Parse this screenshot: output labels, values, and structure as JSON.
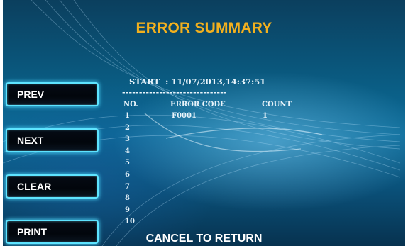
{
  "title": "ERROR SUMMARY",
  "buttons": {
    "prev": "PREV",
    "next": "NEXT",
    "clear": "CLEAR",
    "print": "PRINT"
  },
  "report": {
    "start_line": "START  : 11/07/2013,14:37:51",
    "divider": "-------------------------------",
    "headers": {
      "no": "NO.",
      "code": "ERROR CODE",
      "count": "COUNT"
    },
    "rows": [
      {
        "no": "1",
        "code": "F0001",
        "count": "1"
      },
      {
        "no": "2",
        "code": "",
        "count": ""
      },
      {
        "no": "3",
        "code": "",
        "count": ""
      },
      {
        "no": "4",
        "code": "",
        "count": ""
      },
      {
        "no": "5",
        "code": "",
        "count": ""
      },
      {
        "no": "6",
        "code": "",
        "count": ""
      },
      {
        "no": "7",
        "code": "",
        "count": ""
      },
      {
        "no": "8",
        "code": "",
        "count": ""
      },
      {
        "no": "9",
        "code": "",
        "count": ""
      },
      {
        "no": "10",
        "code": "",
        "count": ""
      }
    ]
  },
  "footer": "CANCEL TO RETURN",
  "colors": {
    "title": "#f2b01e",
    "button_glow": "#5ee4ff",
    "background": "#0a5d84"
  }
}
